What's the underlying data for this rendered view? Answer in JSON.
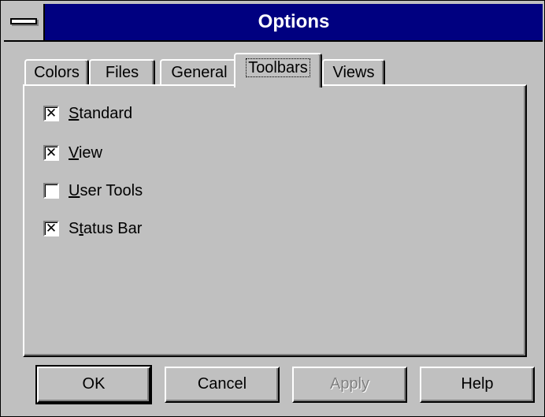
{
  "window": {
    "title": "Options"
  },
  "tabs": [
    {
      "label": "Colors",
      "active": false
    },
    {
      "label": "Files",
      "active": false
    },
    {
      "label": "General",
      "active": false
    },
    {
      "label": "Toolbars",
      "active": true
    },
    {
      "label": "Views",
      "active": false
    }
  ],
  "options": [
    {
      "label": "Standard",
      "mnemonic": "S",
      "rest": "tandard",
      "checked": true
    },
    {
      "label": "View",
      "mnemonic": "V",
      "rest": "iew",
      "checked": true
    },
    {
      "label": "User Tools",
      "mnemonic": "U",
      "rest": "ser Tools",
      "checked": false
    },
    {
      "label": "Status Bar",
      "mnemonic": "t",
      "prefix": "S",
      "rest": "atus Bar",
      "checked": true
    }
  ],
  "checkmark": "✕",
  "buttons": {
    "ok": "OK",
    "cancel": "Cancel",
    "apply": "Apply",
    "help": "Help"
  }
}
